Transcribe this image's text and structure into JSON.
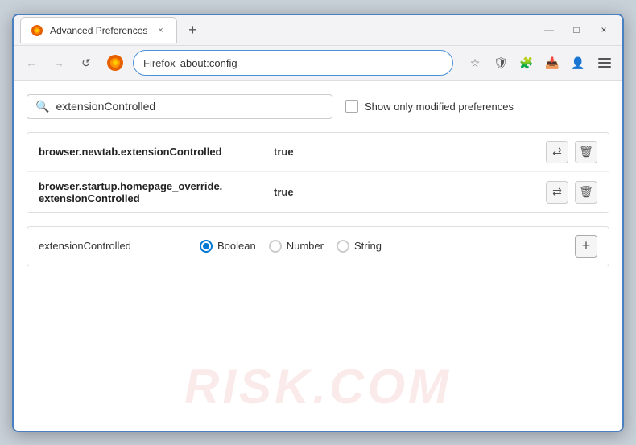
{
  "window": {
    "title": "Advanced Preferences",
    "tab_close_label": "×",
    "new_tab_label": "+",
    "minimize_label": "—",
    "maximize_label": "□",
    "close_label": "×"
  },
  "navbar": {
    "back_label": "←",
    "forward_label": "→",
    "reload_label": "↺",
    "firefox_label": "Firefox",
    "url": "about:config",
    "bookmark_icon": "☆",
    "shield_icon": "🛡",
    "extension_icon": "🧩",
    "pocket_icon": "📥",
    "account_icon": "👤",
    "menu_label": "≡"
  },
  "search": {
    "placeholder": "extensionControlled",
    "value": "extensionControlled",
    "show_modified_label": "Show only modified preferences"
  },
  "preferences": [
    {
      "name": "browser.newtab.extensionControlled",
      "value": "true"
    },
    {
      "name_line1": "browser.startup.homepage_override.",
      "name_line2": "extensionControlled",
      "value": "true"
    }
  ],
  "new_pref": {
    "name": "extensionControlled",
    "type_boolean_label": "Boolean",
    "type_number_label": "Number",
    "type_string_label": "String",
    "add_label": "+",
    "selected_type": "boolean"
  },
  "watermark": "RISK.COM",
  "icons": {
    "search": "🔍",
    "reset": "⇄",
    "delete": "🗑",
    "add": "+"
  }
}
